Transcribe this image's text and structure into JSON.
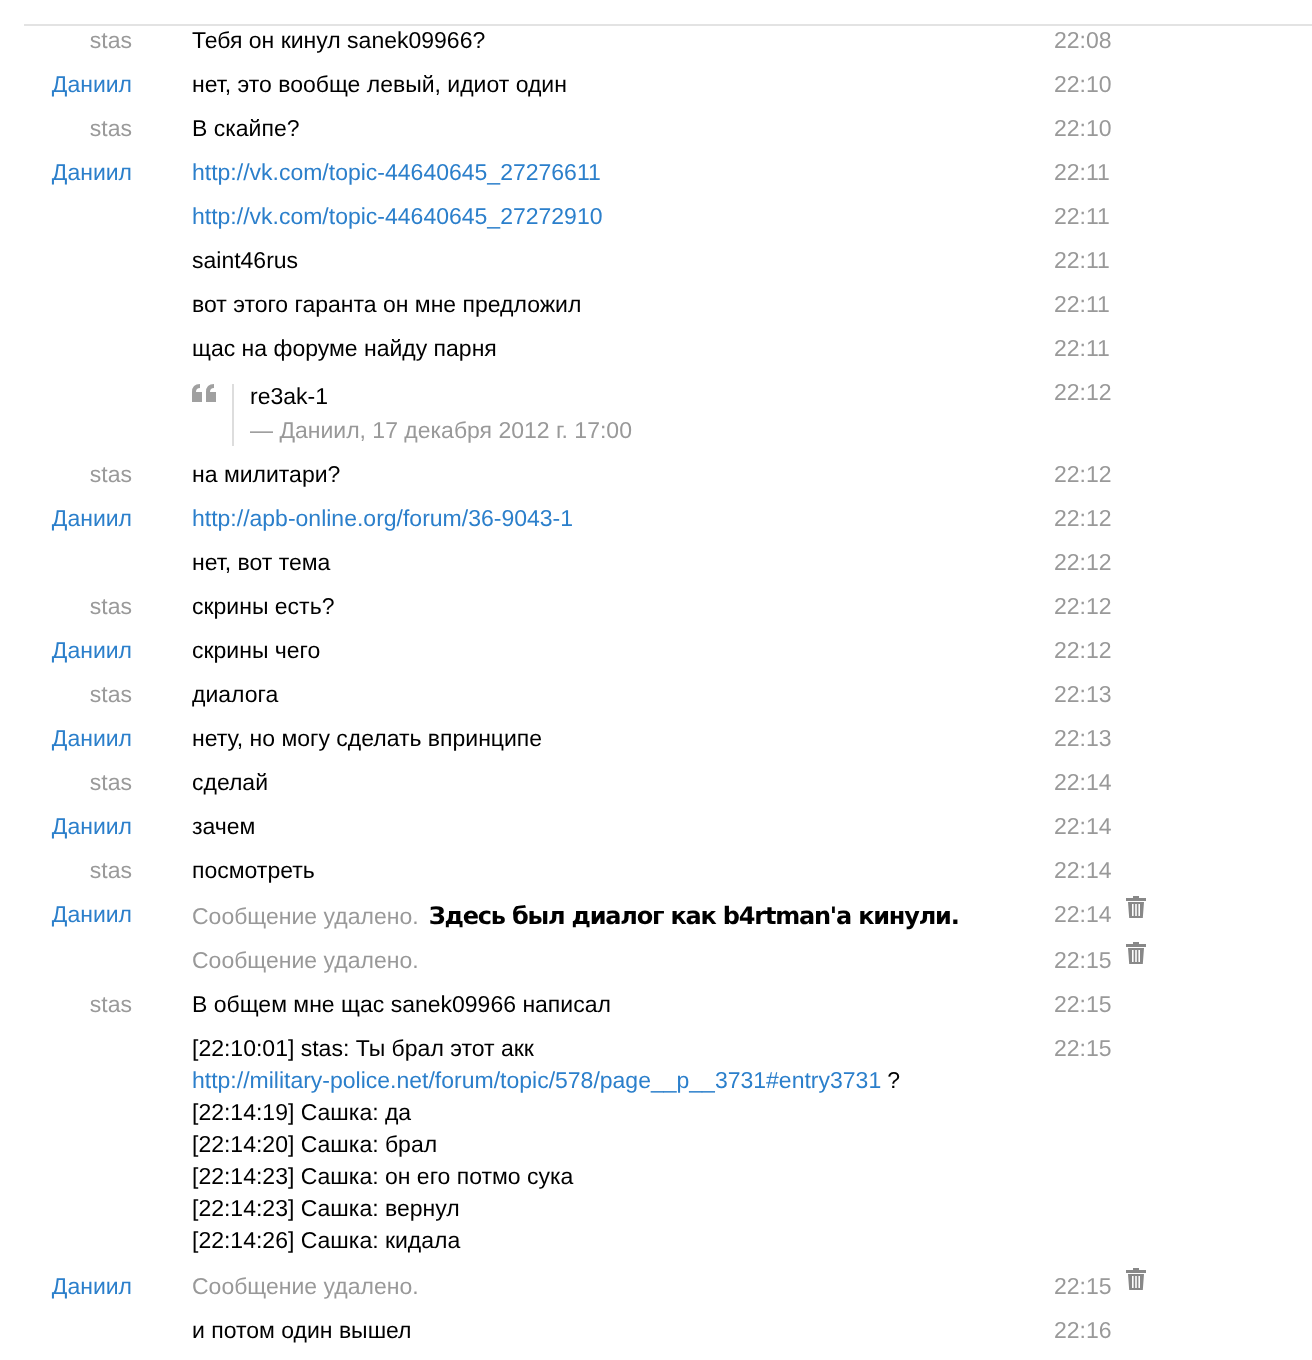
{
  "messages": [
    {
      "author": "stas",
      "color": "#9a9a9a",
      "time": "22:08",
      "lines": [
        [
          {
            "text": "Тебя он кинул sanek09966?",
            "link": false
          }
        ]
      ]
    },
    {
      "author": "Даниил",
      "color": "#2b7fcb",
      "time": "22:10",
      "lines": [
        [
          {
            "text": "нет, это вообще левый, идиот один",
            "link": false
          }
        ]
      ]
    },
    {
      "author": "stas",
      "color": "#9a9a9a",
      "time": "22:10",
      "lines": [
        [
          {
            "text": "В скайпе?",
            "link": false
          }
        ]
      ]
    },
    {
      "author": "Даниил",
      "color": "#2b7fcb",
      "time": "22:11",
      "lines": [
        [
          {
            "text": "http://vk.com/topic-44640645_27276611",
            "link": true
          }
        ]
      ]
    },
    {
      "time": "22:11",
      "lines": [
        [
          {
            "text": "http://vk.com/topic-44640645_27272910",
            "link": true
          }
        ]
      ]
    },
    {
      "time": "22:11",
      "lines": [
        [
          {
            "text": "saint46rus",
            "link": false
          }
        ]
      ]
    },
    {
      "time": "22:11",
      "lines": [
        [
          {
            "text": "вот этого гаранта он мне предложил",
            "link": false
          }
        ]
      ]
    },
    {
      "time": "22:11",
      "lines": [
        [
          {
            "text": "щас на форуме найду парня",
            "link": false
          }
        ]
      ]
    },
    {
      "time": "22:12",
      "quote": {
        "text": "re3ak-1",
        "source": "— Даниил, 17 декабря 2012 г. 17:00"
      }
    },
    {
      "author": "stas",
      "color": "#9a9a9a",
      "time": "22:12",
      "lines": [
        [
          {
            "text": "на милитари?",
            "link": false
          }
        ]
      ]
    },
    {
      "author": "Даниил",
      "color": "#2b7fcb",
      "time": "22:12",
      "lines": [
        [
          {
            "text": "http://apb-online.org/forum/36-9043-1",
            "link": true
          }
        ]
      ]
    },
    {
      "time": "22:12",
      "lines": [
        [
          {
            "text": "нет, вот тема",
            "link": false
          }
        ]
      ]
    },
    {
      "author": "stas",
      "color": "#9a9a9a",
      "time": "22:12",
      "lines": [
        [
          {
            "text": "скрины есть?",
            "link": false
          }
        ]
      ]
    },
    {
      "author": "Даниил",
      "color": "#2b7fcb",
      "time": "22:12",
      "lines": [
        [
          {
            "text": "скрины чего",
            "link": false
          }
        ]
      ]
    },
    {
      "author": "stas",
      "color": "#9a9a9a",
      "time": "22:13",
      "lines": [
        [
          {
            "text": "диалога",
            "link": false
          }
        ]
      ]
    },
    {
      "author": "Даниил",
      "color": "#2b7fcb",
      "time": "22:13",
      "lines": [
        [
          {
            "text": "нету, но могу сделать впринципе",
            "link": false
          }
        ]
      ]
    },
    {
      "author": "stas",
      "color": "#9a9a9a",
      "time": "22:14",
      "lines": [
        [
          {
            "text": "сделай",
            "link": false
          }
        ]
      ]
    },
    {
      "author": "Даниил",
      "color": "#2b7fcb",
      "time": "22:14",
      "lines": [
        [
          {
            "text": "зачем",
            "link": false
          }
        ]
      ]
    },
    {
      "author": "stas",
      "color": "#9a9a9a",
      "time": "22:14",
      "lines": [
        [
          {
            "text": "посмотреть",
            "link": false
          }
        ]
      ]
    },
    {
      "author": "Даниил",
      "color": "#2b7fcb",
      "time": "22:14",
      "deleted": true,
      "deleted_text": "Сообщение удалено.",
      "note": "Здесь был диалог как b4rtman'а кинули."
    },
    {
      "time": "22:15",
      "deleted": true,
      "deleted_text": "Сообщение удалено."
    },
    {
      "author": "stas",
      "color": "#9a9a9a",
      "time": "22:15",
      "lines": [
        [
          {
            "text": "В общем мне щас sanek09966 написал",
            "link": false
          }
        ]
      ]
    },
    {
      "time": "22:15",
      "lines": [
        [
          {
            "text": "[22:10:01] stas: Ты брал этот акк",
            "link": false
          }
        ],
        [
          {
            "text": "http://military-police.net/forum/topic/578/page__p__3731#entry3731",
            "link": true
          },
          {
            "text": "?",
            "link": false
          }
        ],
        [
          {
            "text": "[22:14:19] Сашка: да",
            "link": false
          }
        ],
        [
          {
            "text": "[22:14:20] Сашка: брал",
            "link": false
          }
        ],
        [
          {
            "text": "[22:14:23] Сашка: он его потмо сука",
            "link": false
          }
        ],
        [
          {
            "text": "[22:14:23] Сашка: вернул",
            "link": false
          }
        ],
        [
          {
            "text": "[22:14:26] Сашка: кидала",
            "link": false
          }
        ]
      ]
    },
    {
      "author": "Даниил",
      "color": "#2b7fcb",
      "time": "22:15",
      "deleted": true,
      "deleted_text": "Сообщение удалено."
    },
    {
      "time": "22:16",
      "lines": [
        [
          {
            "text": "и потом один вышел",
            "link": false
          }
        ]
      ]
    }
  ]
}
